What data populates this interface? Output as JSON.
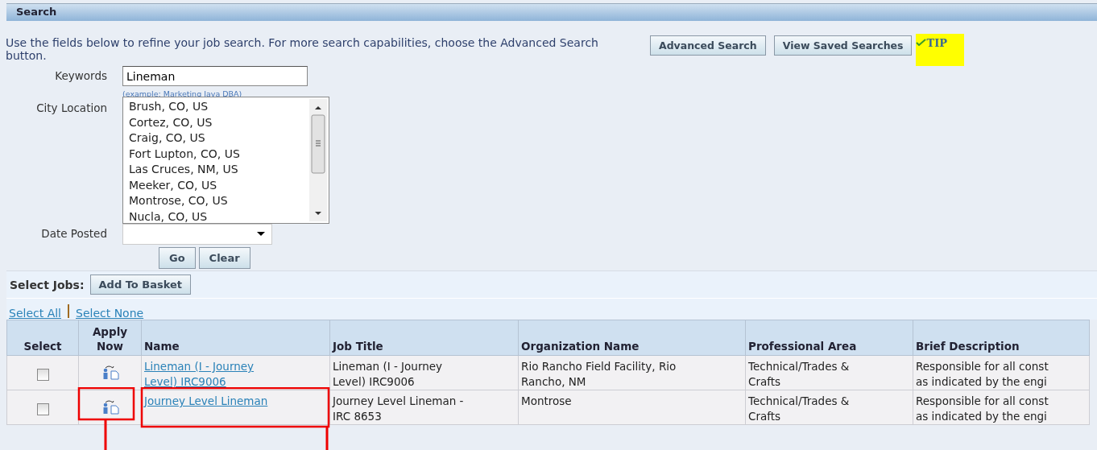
{
  "header": {
    "title": "Search"
  },
  "intro": "Use the fields below to refine your job search. For more search capabilities, choose the Advanced Search button.",
  "top_buttons": [
    "Advanced Search",
    "View Saved Searches"
  ],
  "tip": {
    "label": "TIP"
  },
  "keywords": {
    "label": "Keywords",
    "value": "Lineman",
    "hint": "(example: Marketing Java DBA)"
  },
  "city_location": {
    "label": "City Location",
    "options": [
      "Brush, CO, US",
      "Cortez, CO, US",
      "Craig, CO, US",
      "Fort Lupton, CO, US",
      "Las Cruces, NM, US",
      "Meeker, CO, US",
      "Montrose, CO, US",
      "Nucla, CO, US"
    ]
  },
  "date_posted": {
    "label": "Date Posted"
  },
  "form_buttons": [
    "Go",
    "Clear"
  ],
  "select_jobs": {
    "label": "Select Jobs:",
    "button": "Add To Basket"
  },
  "select_links": [
    "Select All",
    "Select None"
  ],
  "table": {
    "columns": [
      [
        "Select"
      ],
      [
        "Apply",
        "Now"
      ],
      [
        "Name"
      ],
      [
        "Job Title"
      ],
      [
        "Organization Name"
      ],
      [
        "Professional Area"
      ],
      [
        "Brief Description"
      ]
    ],
    "rows": [
      {
        "checked": false,
        "name": [
          "Lineman (I - Journey",
          "Level) IRC9006"
        ],
        "job_title": [
          "Lineman (I - Journey",
          "Level) IRC9006"
        ],
        "organization": [
          "Rio Rancho Field Facility, Rio",
          "Rancho, NM"
        ],
        "area": [
          "Technical/Trades &",
          "Crafts"
        ],
        "description": [
          "Responsible for all const",
          "as indicated by the engi"
        ]
      },
      {
        "checked": false,
        "name": [
          "Journey Level Lineman"
        ],
        "job_title": [
          "Journey Level Lineman -",
          "IRC 8653"
        ],
        "organization": [
          "Montrose"
        ],
        "area": [
          "Technical/Trades &",
          "Crafts"
        ],
        "description": [
          "Responsible for all const",
          "as indicated by the engi"
        ]
      }
    ]
  }
}
